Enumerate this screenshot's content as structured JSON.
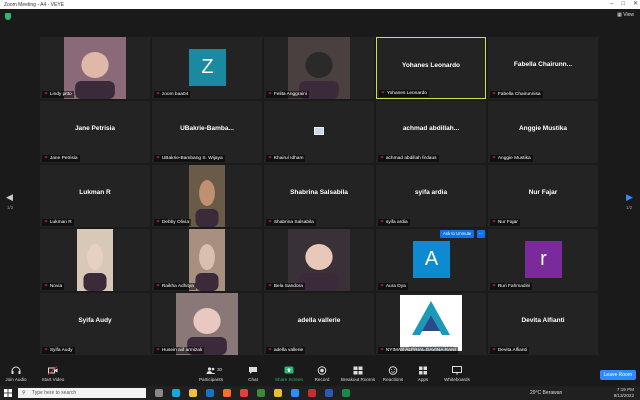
{
  "window": {
    "title": "Zoom Meeting - A4 - VEYE",
    "view_label": "View"
  },
  "participants": [
    {
      "label": "Lindy pitto",
      "kind": "photo",
      "skin": "#e0b8a8",
      "bg": "#8a6a78"
    },
    {
      "label": "zoom baa04",
      "kind": "avatar",
      "letter": "Z",
      "color": "#1a8aa0"
    },
    {
      "label": "Felita Anggraini",
      "kind": "photo",
      "skin": "#2a2a2a",
      "bg": "#4a4040"
    },
    {
      "label": "Yohanes Leonardo",
      "name": "Yohanes Leonardo",
      "kind": "name",
      "active": true
    },
    {
      "label": "Fabella Chairunnisa",
      "name": "Fabella  Chairunn...",
      "kind": "name"
    },
    {
      "label": "Jane Petrisia",
      "name": "Jane Petrisia",
      "kind": "name"
    },
    {
      "label": "UBakrie-Bambang S. Wijaya",
      "name": "UBakrie-Bamba...",
      "kind": "name"
    },
    {
      "label": "Khairul Idham",
      "kind": "thumb"
    },
    {
      "label": "achmad abdillah firdaus",
      "name": "achmad  abdillah...",
      "kind": "name"
    },
    {
      "label": "Anggie Mustika",
      "name": "Anggie Mustika",
      "kind": "name"
    },
    {
      "label": "Lukman R",
      "name": "Lukman R",
      "kind": "name"
    },
    {
      "label": "Debby Olivia",
      "kind": "photo",
      "skin": "#c09070",
      "bg": "#6a5a48"
    },
    {
      "label": "Shabrina Salsabila",
      "name": "Shabrina Salsabila",
      "kind": "name"
    },
    {
      "label": "syifa ardia",
      "name": "syifa ardia",
      "kind": "name"
    },
    {
      "label": "Nur Fajar",
      "name": "Nur Fajar",
      "kind": "name"
    },
    {
      "label": "Novia",
      "kind": "photo",
      "skin": "#e8d0c0",
      "bg": "#d8c8b8"
    },
    {
      "label": "Raikha Adhitya",
      "kind": "photo",
      "skin": "#d8c0b0",
      "bg": "#a89080"
    },
    {
      "label": "Bela Sandora",
      "kind": "photo",
      "skin": "#e8c8b8",
      "bg": "#3a3038"
    },
    {
      "label": "Aura Dya",
      "kind": "avatar",
      "letter": "A",
      "color": "#0e8ad0",
      "unmute": true
    },
    {
      "label": "Ruri Fahmadini",
      "kind": "avatar",
      "letter": "r",
      "color": "#7a2a9a"
    },
    {
      "label": "Syifa Audy",
      "name": "Syifa Audy",
      "kind": "name"
    },
    {
      "label": "Husein aiif armizak",
      "kind": "photo",
      "skin": "#e8c8c0",
      "bg": "#8a7878"
    },
    {
      "label": "adella vallerie",
      "name": "adella vallerie",
      "kind": "name"
    },
    {
      "label": "NYIMAS ALFRIAL DAVINA RANI",
      "kind": "logo",
      "logo_text": "PT DAGINA INDUSTRI ASIA"
    },
    {
      "label": "Devita Alfianti",
      "name": "Devita Alfianti",
      "kind": "name"
    }
  ],
  "unmute": {
    "ask_label": "Ask to Unmute",
    "more": "..."
  },
  "pager": {
    "left": "1/2",
    "right": "1/2"
  },
  "toolbar": {
    "join_audio": "Join Audio",
    "start_video": "Start Video",
    "participants": "Participants",
    "participant_count": "30",
    "chat": "Chat",
    "share_screen": "Share Screen",
    "record": "Record",
    "breakout": "Breakout Rooms",
    "reactions": "Reactions",
    "apps": "Apps",
    "whiteboards": "Whiteboards",
    "leave": "Leave Room"
  },
  "taskbar": {
    "search_placeholder": "Type here to search",
    "weather": "29°C  Berawan",
    "time": "7:19 PM",
    "date": "9/13/2022"
  },
  "colors": {
    "accent": "#2d8cff",
    "active_border": "#c9e24a",
    "muted_mic": "#e02828",
    "share": "#2eb872"
  }
}
